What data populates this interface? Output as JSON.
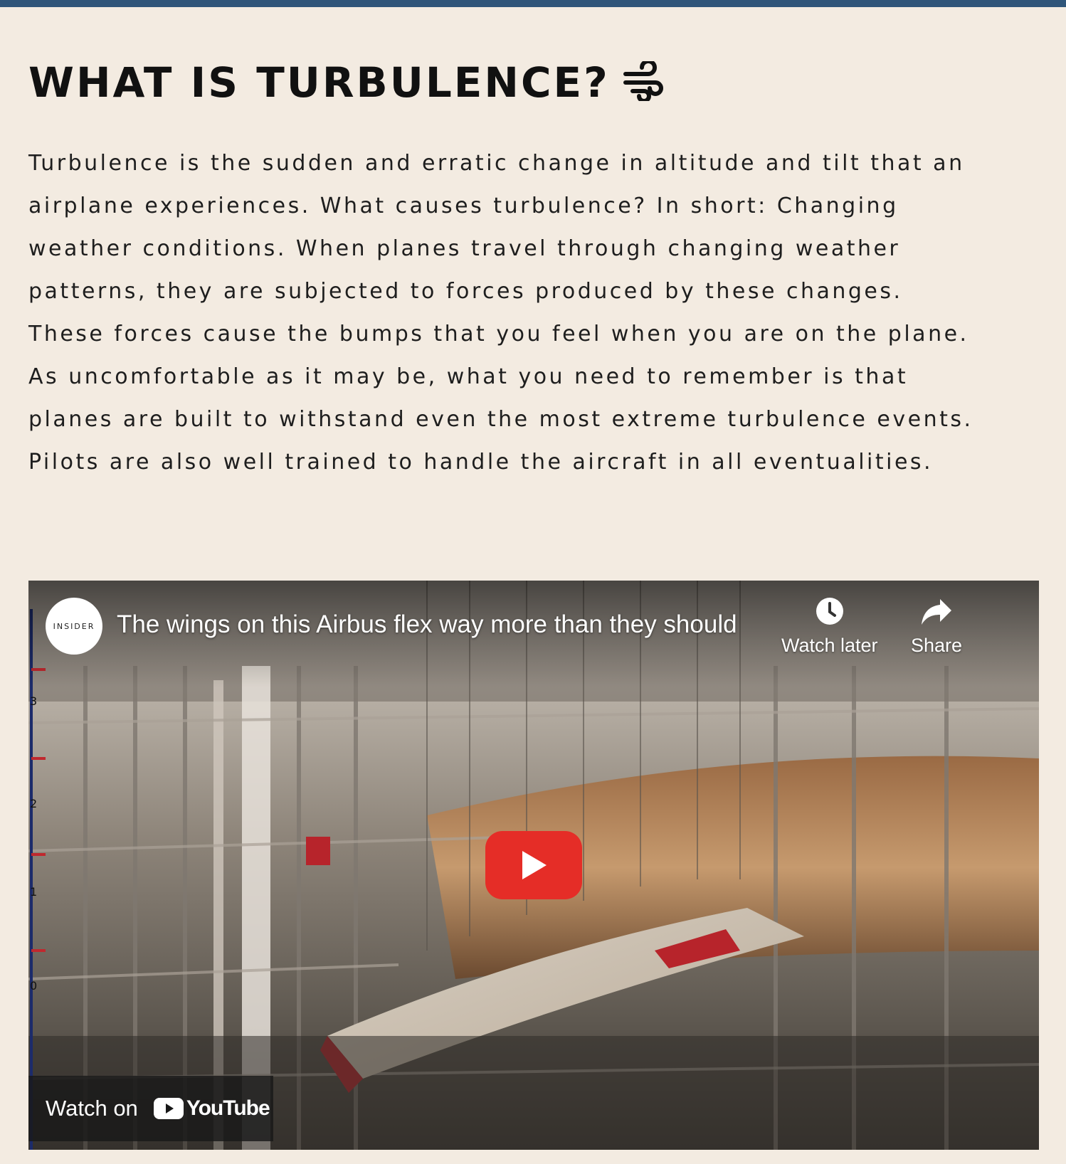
{
  "section": {
    "heading": "WHAT IS TURBULENCE?",
    "heading_icon": "wind-icon",
    "paragraph_lines": [
      "Turbulence is the sudden and erratic change in altitude and tilt that an",
      "airplane experiences. What causes turbulence? In short: Changing",
      "weather conditions. When planes travel through changing weather",
      "patterns, they are subjected to forces produced by these changes.",
      "These forces cause the bumps that you feel when you are on the plane.",
      "As uncomfortable as it may be, what you need to remember is that",
      "planes are built to withstand even the most extreme turbulence events.",
      "Pilots are also well trained to handle the aircraft in all eventualities."
    ]
  },
  "video": {
    "channel_logo_text": "INSIDER",
    "title": "The wings on this Airbus flex way more than they should",
    "watch_later_label": "Watch later",
    "share_label": "Share",
    "watch_on_label": "Watch on",
    "youtube_wordmark": "YouTube",
    "play_icon": "play-icon",
    "scale_marks": [
      "3",
      "2",
      "1",
      "0"
    ]
  },
  "colors": {
    "page_background": "#f3ebe1",
    "top_bar": "#2f5579",
    "play_button": "#e52d27"
  }
}
